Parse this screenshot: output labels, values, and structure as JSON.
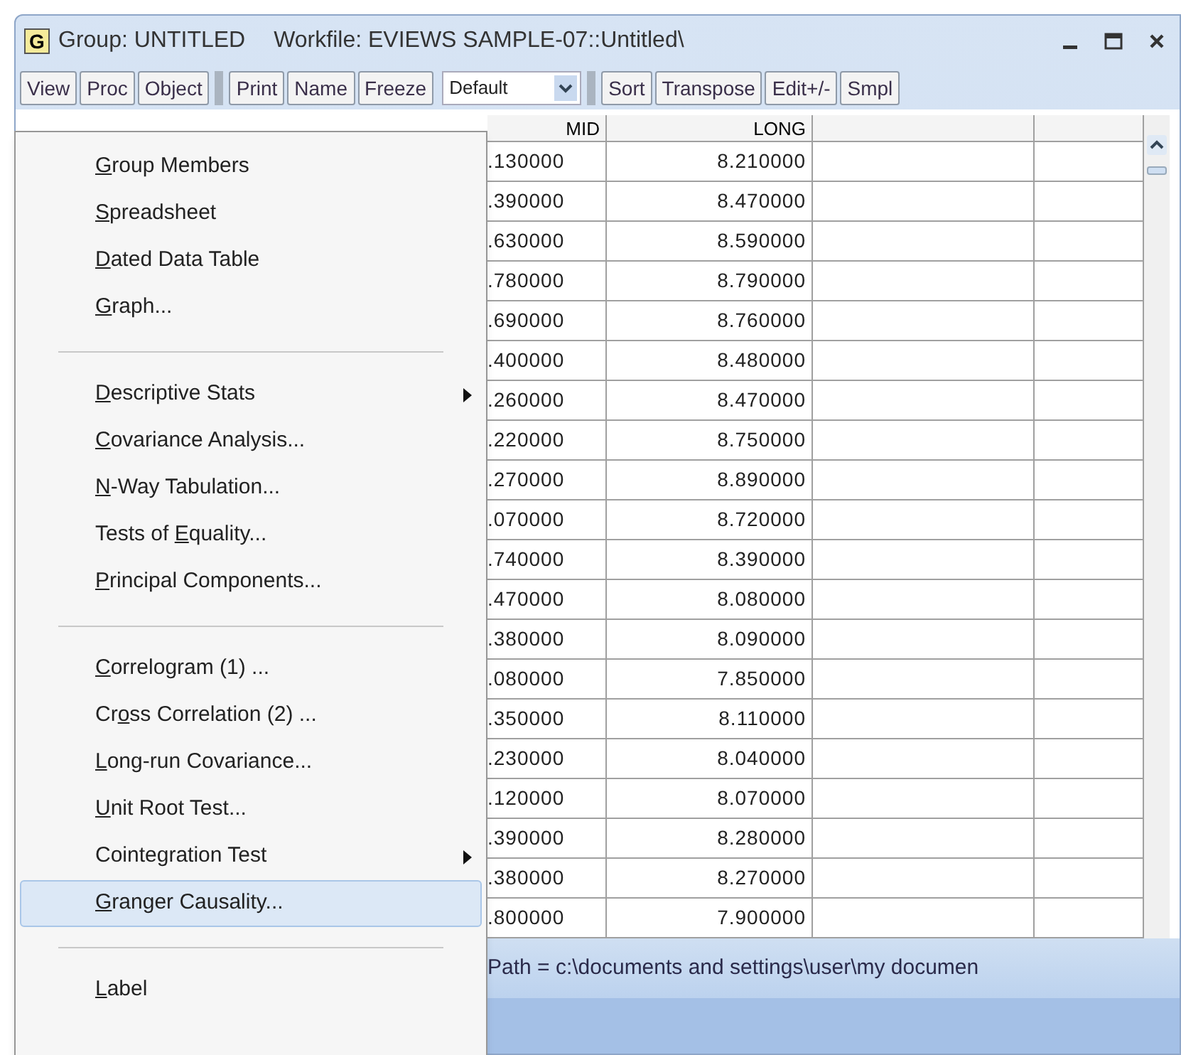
{
  "window": {
    "icon_letter": "G",
    "title": "Group: UNTITLED",
    "workfile": "Workfile: EVIEWS SAMPLE-07::Untitled\\"
  },
  "toolbar": {
    "groups": [
      [
        "View",
        "Proc",
        "Object"
      ],
      [
        "Print",
        "Name",
        "Freeze"
      ]
    ],
    "combo": {
      "value": "Default"
    },
    "buttons_after": [
      "Sort",
      "Transpose",
      "Edit+/-",
      "Smpl"
    ]
  },
  "table": {
    "columns": [
      "MID",
      "LONG",
      "",
      ""
    ],
    "rows": [
      [
        ".130000",
        "8.210000"
      ],
      [
        ".390000",
        "8.470000"
      ],
      [
        ".630000",
        "8.590000"
      ],
      [
        ".780000",
        "8.790000"
      ],
      [
        ".690000",
        "8.760000"
      ],
      [
        ".400000",
        "8.480000"
      ],
      [
        ".260000",
        "8.470000"
      ],
      [
        ".220000",
        "8.750000"
      ],
      [
        ".270000",
        "8.890000"
      ],
      [
        ".070000",
        "8.720000"
      ],
      [
        ".740000",
        "8.390000"
      ],
      [
        ".470000",
        "8.080000"
      ],
      [
        ".380000",
        "8.090000"
      ],
      [
        ".080000",
        "7.850000"
      ],
      [
        ".350000",
        "8.110000"
      ],
      [
        ".230000",
        "8.040000"
      ],
      [
        ".120000",
        "8.070000"
      ],
      [
        ".390000",
        "8.280000"
      ],
      [
        ".380000",
        "8.270000"
      ],
      [
        ".800000",
        "7.900000"
      ]
    ]
  },
  "status_bar": "Path = c:\\documents and settings\\user\\my documen",
  "menu": {
    "items": [
      {
        "kind": "item",
        "key": "G",
        "post": "roup Members",
        "submenu": false,
        "selected": false
      },
      {
        "kind": "item",
        "key": "S",
        "post": "preadsheet",
        "submenu": false,
        "selected": false
      },
      {
        "kind": "item",
        "key": "D",
        "post": "ated Data Table",
        "submenu": false,
        "selected": false
      },
      {
        "kind": "item",
        "key": "G",
        "post": "raph...",
        "submenu": false,
        "selected": false
      },
      {
        "kind": "separator"
      },
      {
        "kind": "item",
        "key": "D",
        "post": "escriptive Stats",
        "submenu": true,
        "selected": false
      },
      {
        "kind": "item",
        "key": "C",
        "post": "ovariance Analysis...",
        "submenu": false,
        "selected": false
      },
      {
        "kind": "item",
        "key": "N",
        "post": "-Way Tabulation...",
        "submenu": false,
        "selected": false
      },
      {
        "kind": "item",
        "pre": "Tests of ",
        "key": "E",
        "post": "quality...",
        "submenu": false,
        "selected": false
      },
      {
        "kind": "item",
        "key": "P",
        "post": "rincipal Components...",
        "submenu": false,
        "selected": false
      },
      {
        "kind": "separator"
      },
      {
        "kind": "item",
        "key": "C",
        "post": "orrelogram (1) ...",
        "submenu": false,
        "selected": false
      },
      {
        "kind": "item",
        "pre": "Cr",
        "key": "o",
        "post": "ss Correlation (2) ...",
        "submenu": false,
        "selected": false
      },
      {
        "kind": "item",
        "key": "L",
        "post": "ong-run Covariance...",
        "submenu": false,
        "selected": false
      },
      {
        "kind": "item",
        "key": "U",
        "post": "nit Root Test...",
        "submenu": false,
        "selected": false
      },
      {
        "kind": "item",
        "pre": "Cointegration Test",
        "submenu": true,
        "selected": false
      },
      {
        "kind": "item",
        "key": "G",
        "post": "ranger Causality...",
        "submenu": false,
        "selected": true
      },
      {
        "kind": "separator"
      },
      {
        "kind": "item",
        "key": "L",
        "post": "abel",
        "submenu": false,
        "selected": false
      }
    ]
  }
}
